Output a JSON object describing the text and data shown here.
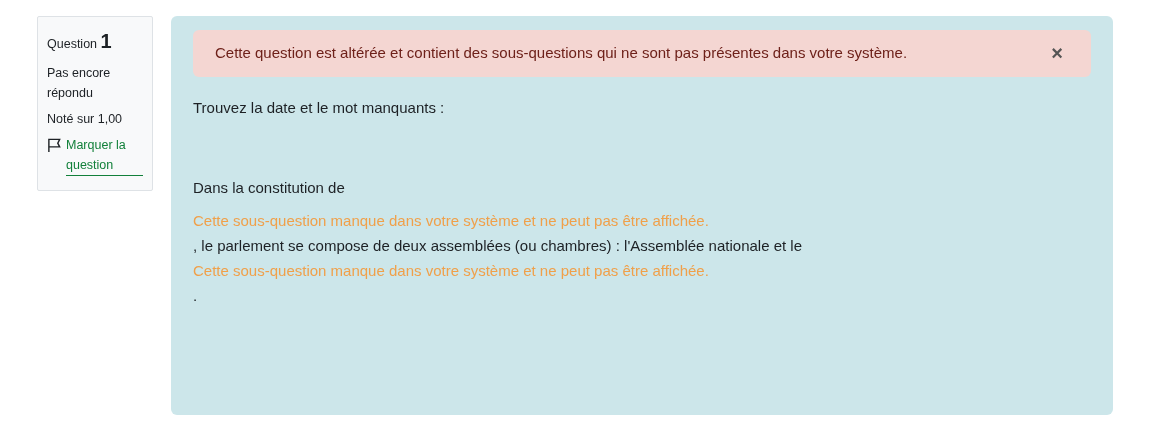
{
  "info": {
    "label": "Question",
    "number": "1",
    "status": "Pas encore répondu",
    "grade": "Noté sur 1,00",
    "flag_link": "Marquer la question"
  },
  "alert": {
    "message": "Cette question est altérée et contient des sous-questions qui ne sont pas présentes dans votre système.",
    "close": "×"
  },
  "prompt": "Trouvez la date et le mot manquants :",
  "content": [
    {
      "kind": "text",
      "text": "Dans la constitution de"
    },
    {
      "kind": "missing",
      "text": "Cette sous-question manque dans votre système et ne peut pas être affichée."
    },
    {
      "kind": "text",
      "text": ", le parlement se compose de deux assemblées (ou chambres) : l'Assemblée nationale et le"
    },
    {
      "kind": "missing",
      "text": "Cette sous-question manque dans votre système et ne peut pas être affichée."
    },
    {
      "kind": "text",
      "text": "."
    }
  ]
}
